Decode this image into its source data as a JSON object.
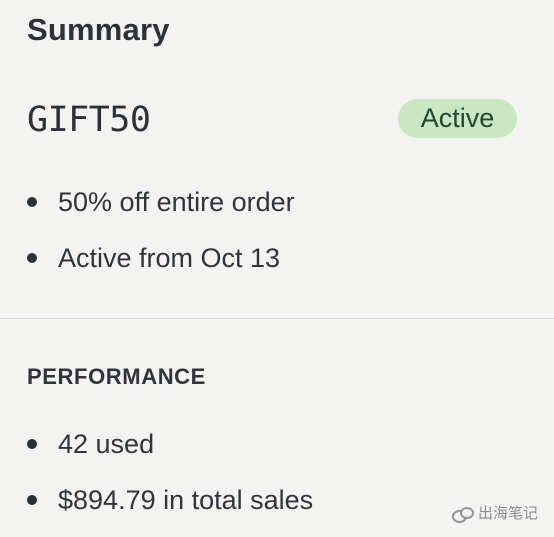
{
  "summary": {
    "title": "Summary",
    "code": "GIFT50",
    "status": "Active",
    "details": [
      "50% off entire order",
      "Active from Oct 13"
    ]
  },
  "performance": {
    "heading": "PERFORMANCE",
    "items": [
      "42 used",
      "$894.79 in total sales"
    ]
  },
  "watermark": {
    "icon": "wechat-icon",
    "text": "出海笔记"
  },
  "colors": {
    "background": "#f3f3f2",
    "text": "#2b2f36",
    "active_badge_bg": "#c9e7c3",
    "active_badge_text": "#244630",
    "divider": "#d7d8da"
  }
}
